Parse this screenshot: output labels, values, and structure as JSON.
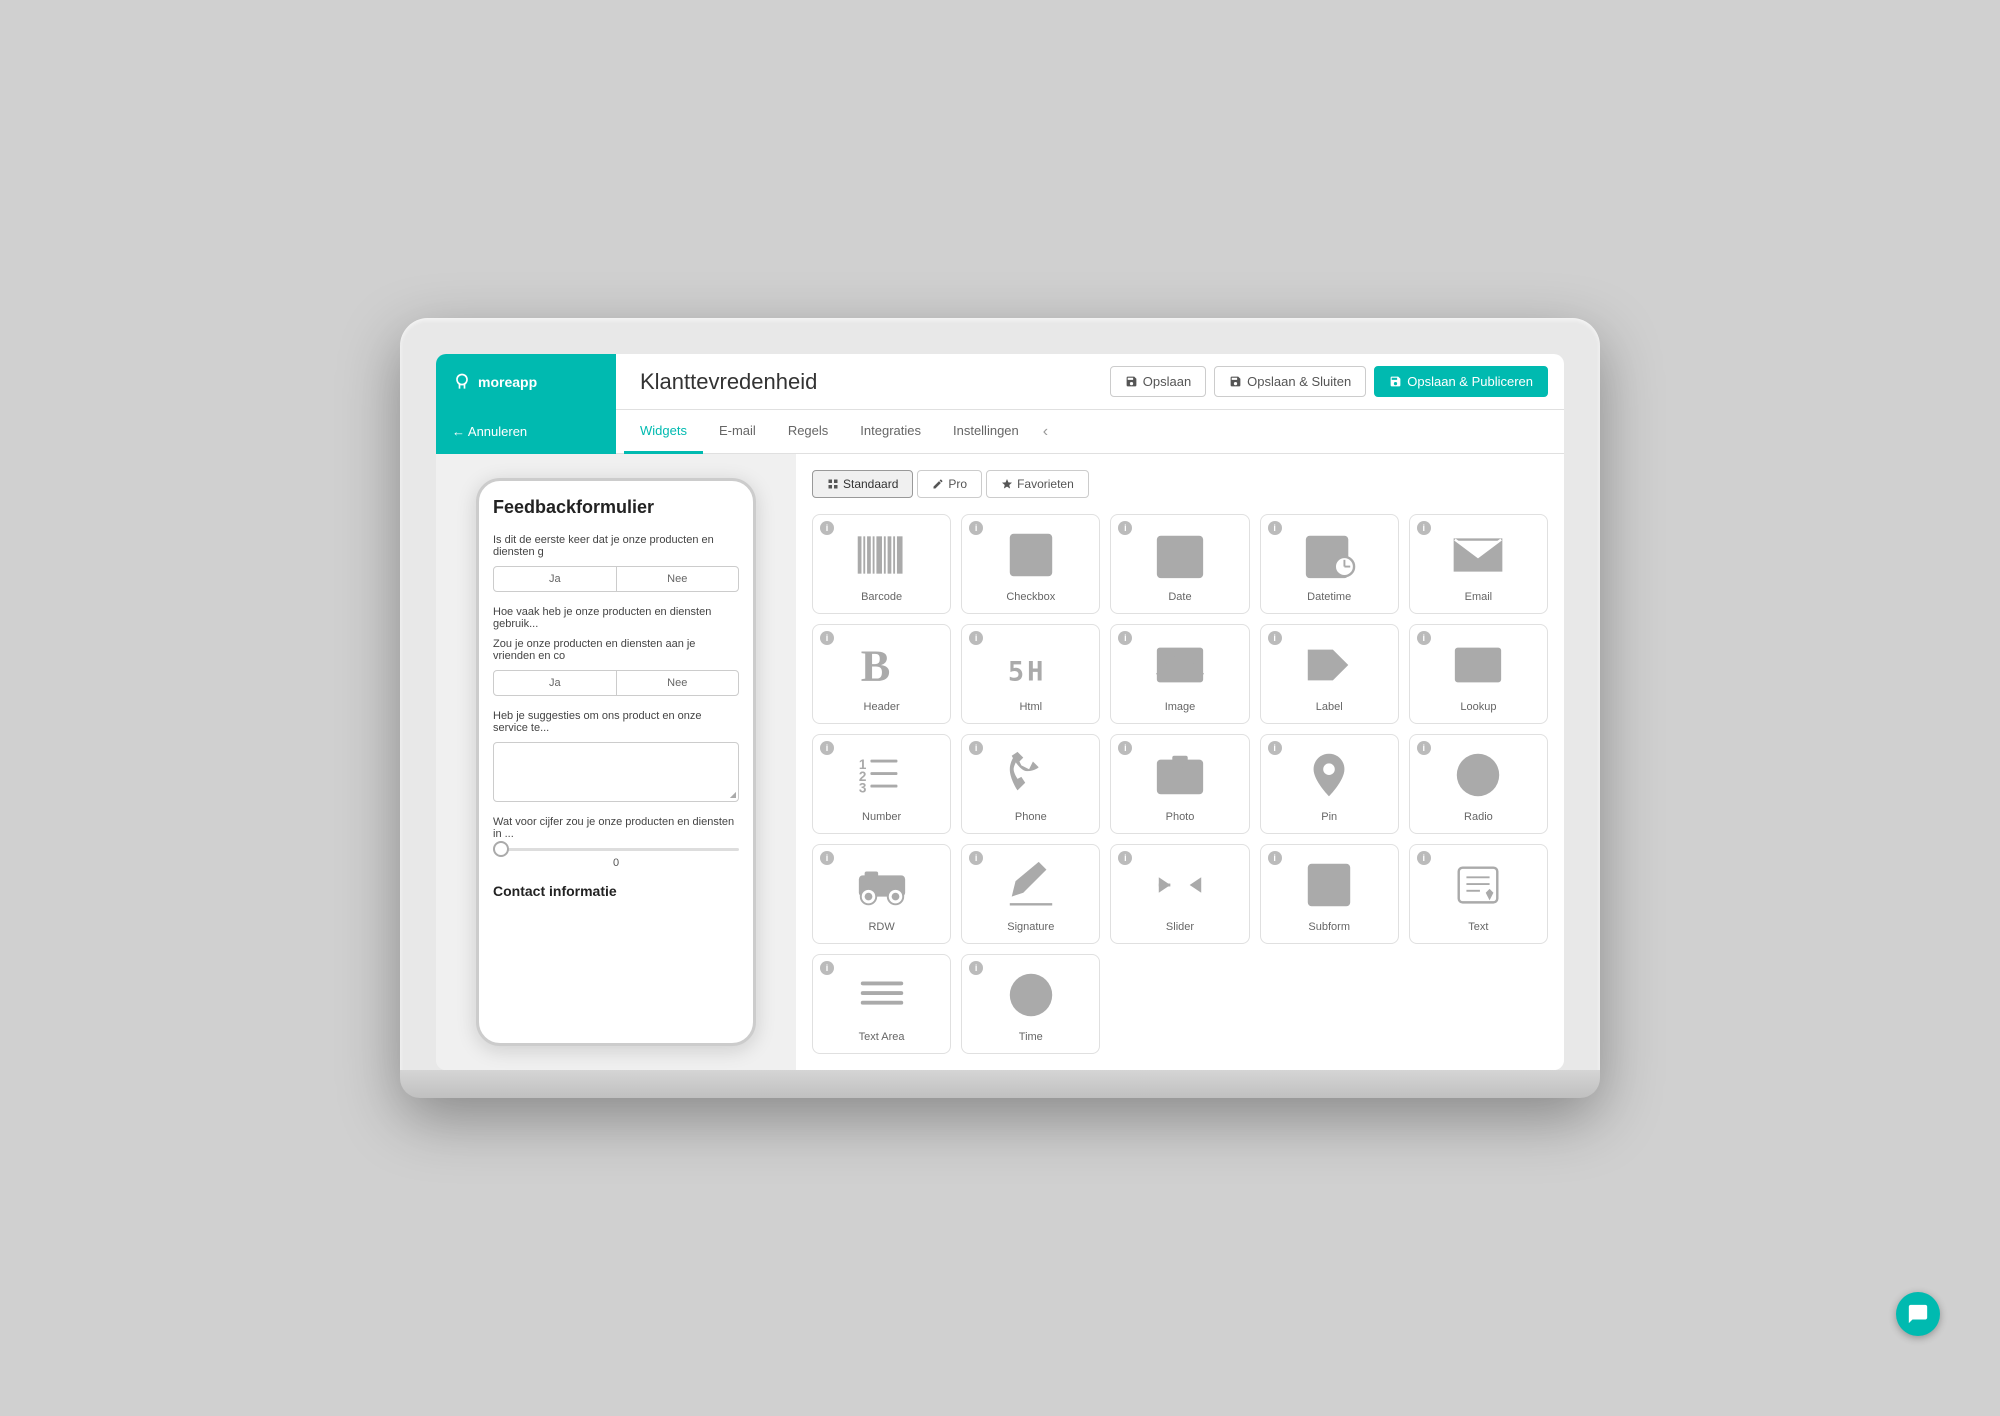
{
  "header": {
    "logo": "moreapp",
    "page_title": "Klanttevredenheid"
  },
  "top_actions": {
    "save_label": "Opslaan",
    "save_close_label": "Opslaan & Sluiten",
    "save_publish_label": "Opslaan & Publiceren"
  },
  "nav": {
    "annuleren_label": "← Annuleren",
    "tabs": [
      {
        "label": "Widgets",
        "active": true
      },
      {
        "label": "E-mail",
        "active": false
      },
      {
        "label": "Regels",
        "active": false
      },
      {
        "label": "Integraties",
        "active": false
      },
      {
        "label": "Instellingen",
        "active": false
      }
    ]
  },
  "phone_preview": {
    "form_title": "Feedbackformulier",
    "questions": [
      {
        "text": "Is dit de eerste keer dat je onze producten en diensten g",
        "type": "yes_no",
        "yes": "Ja",
        "no": "Nee"
      },
      {
        "text": "Hoe vaak heb je onze producten en diensten gebruik...",
        "type": "text"
      },
      {
        "text": "Zou je onze producten en diensten aan je vrienden en co",
        "type": "yes_no",
        "yes": "Ja",
        "no": "Nee"
      },
      {
        "text": "Heb je suggesties om ons product en onze service te...",
        "type": "textarea"
      },
      {
        "text": "Wat voor cijfer zou je onze producten en diensten in ...",
        "type": "slider",
        "value": "0"
      }
    ],
    "section_title": "Contact informatie"
  },
  "widget_tabs": [
    {
      "label": "Standaard",
      "icon": "grid-icon"
    },
    {
      "label": "Pro",
      "icon": "pen-icon"
    },
    {
      "label": "Favorieten",
      "icon": "star-icon"
    }
  ],
  "widgets": [
    {
      "id": "barcode",
      "label": "Barcode"
    },
    {
      "id": "checkbox",
      "label": "Checkbox"
    },
    {
      "id": "date",
      "label": "Date"
    },
    {
      "id": "datetime",
      "label": "Datetime"
    },
    {
      "id": "email",
      "label": "Email"
    },
    {
      "id": "header",
      "label": "Header"
    },
    {
      "id": "html",
      "label": "Html"
    },
    {
      "id": "image",
      "label": "Image"
    },
    {
      "id": "label",
      "label": "Label"
    },
    {
      "id": "lookup",
      "label": "Lookup"
    },
    {
      "id": "number",
      "label": "Number"
    },
    {
      "id": "phone",
      "label": "Phone"
    },
    {
      "id": "photo",
      "label": "Photo"
    },
    {
      "id": "pin",
      "label": "Pin"
    },
    {
      "id": "radio",
      "label": "Radio"
    },
    {
      "id": "rdw",
      "label": "RDW"
    },
    {
      "id": "signature",
      "label": "Signature"
    },
    {
      "id": "slider",
      "label": "Slider"
    },
    {
      "id": "subform",
      "label": "Subform"
    },
    {
      "id": "text",
      "label": "Text"
    },
    {
      "id": "text_area",
      "label": "Text Area"
    },
    {
      "id": "time",
      "label": "Time"
    }
  ]
}
